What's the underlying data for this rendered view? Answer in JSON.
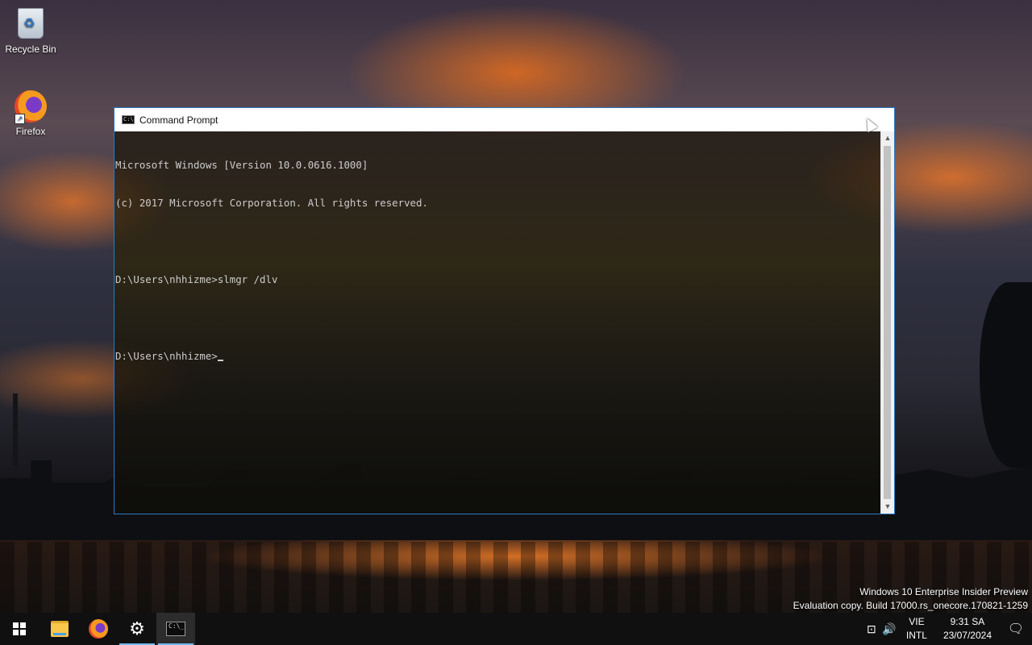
{
  "desktop": {
    "icons": [
      {
        "label": "Recycle Bin",
        "icon": "recycle-bin-icon"
      },
      {
        "label": "Firefox",
        "icon": "firefox-icon"
      }
    ]
  },
  "cmd_window": {
    "title": "Command Prompt",
    "lines": [
      "Microsoft Windows [Version 10.0.0616.1000]",
      "(c) 2017 Microsoft Corporation. All rights reserved.",
      "",
      "D:\\Users\\nhhizme>slmgr /dlv",
      "",
      "D:\\Users\\nhhizme>"
    ],
    "scroll_up_glyph": "▲",
    "scroll_down_glyph": "▼"
  },
  "watermark": {
    "line1": "Windows 10 Enterprise Insider Preview",
    "line2": "Evaluation copy. Build 17000.rs_onecore.170821-1259"
  },
  "taskbar": {
    "apps": [
      {
        "name": "start-button",
        "icon": "windows-logo-icon"
      },
      {
        "name": "file-explorer",
        "icon": "folder-icon"
      },
      {
        "name": "firefox",
        "icon": "firefox-icon"
      },
      {
        "name": "settings",
        "icon": "gear-icon",
        "glyph": "⚙"
      },
      {
        "name": "command-prompt",
        "icon": "terminal-icon",
        "glyph": "C:\\_"
      }
    ],
    "tray": {
      "network_glyph": "⊡",
      "volume_glyph": "🔊",
      "language_top": "VIE",
      "language_bottom": "INTL",
      "time": "9:31 SA",
      "date": "23/07/2024",
      "notification_glyph": "🗨"
    }
  },
  "colors": {
    "window_border": "#2b79c5",
    "taskbar_bg": "#101010",
    "active_indicator": "#76b9ed"
  }
}
